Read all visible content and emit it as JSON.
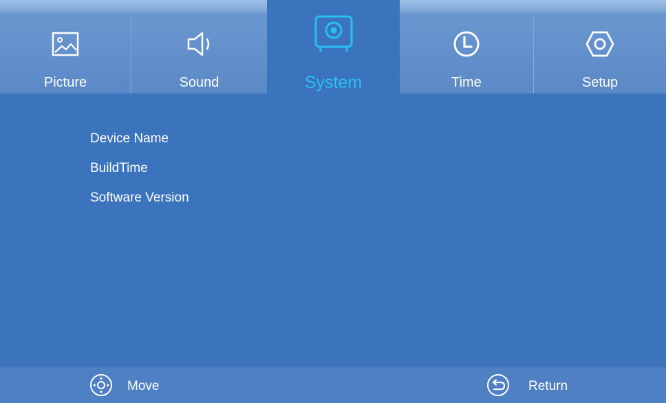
{
  "tabs": [
    {
      "label": "Picture",
      "icon": "picture-icon"
    },
    {
      "label": "Sound",
      "icon": "speaker-icon"
    },
    {
      "label": "System",
      "icon": "system-safe-icon",
      "active": true
    },
    {
      "label": "Time",
      "icon": "clock-icon"
    },
    {
      "label": "Setup",
      "icon": "hexagon-setup-icon"
    }
  ],
  "system": {
    "items": [
      "Device Name",
      "BuildTime",
      "Software Version"
    ]
  },
  "footer": {
    "move_label": "Move",
    "return_label": "Return"
  },
  "colors": {
    "background": "#3b74bd",
    "tab_inactive": "#6b97d0",
    "active_label": "#28c0f2",
    "footer": "#4f80c3",
    "text": "#ffffff"
  }
}
